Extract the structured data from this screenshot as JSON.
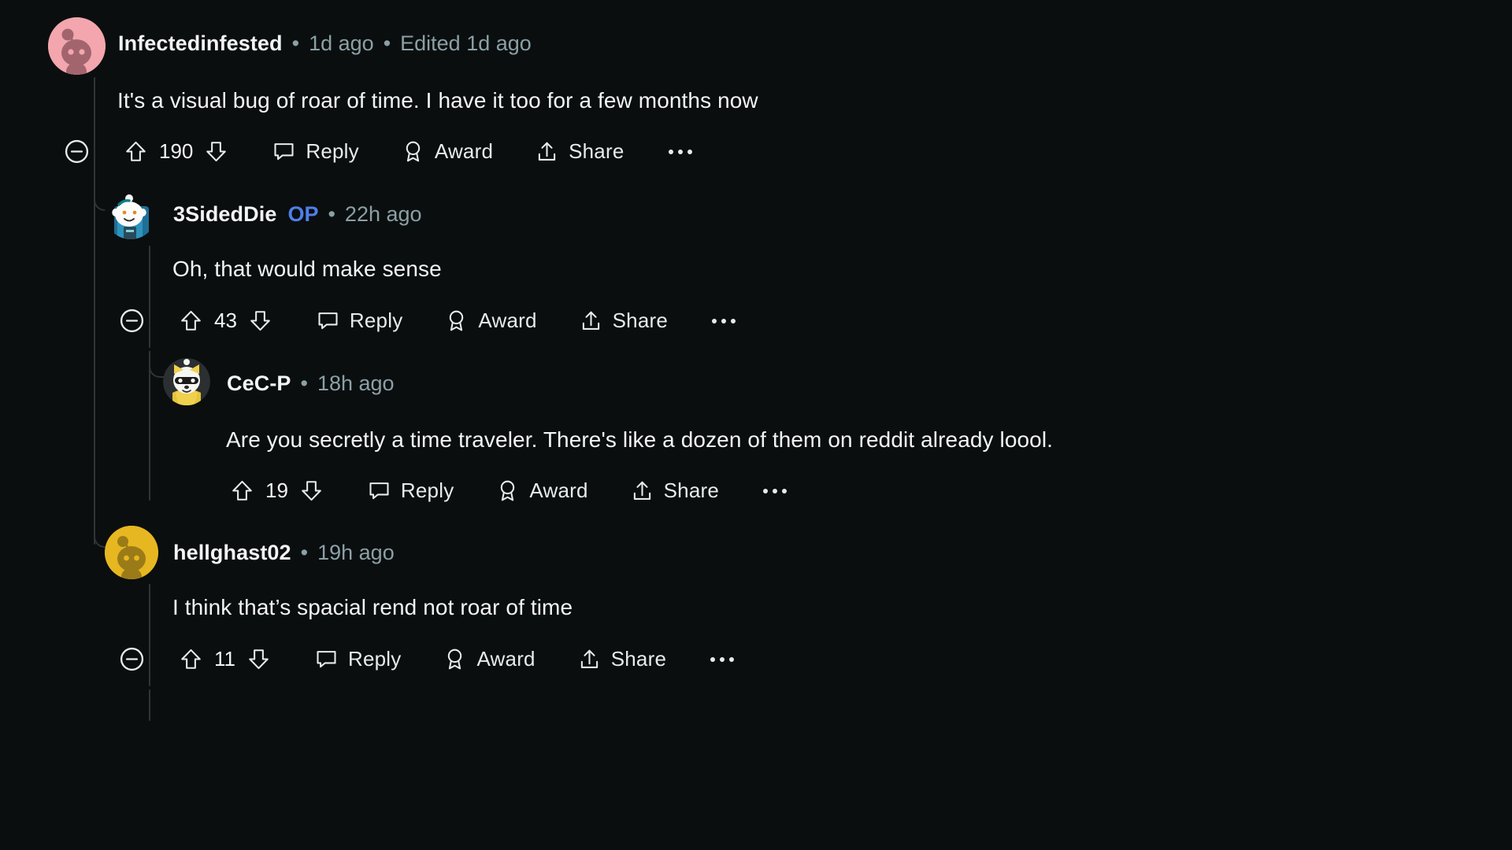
{
  "theme": {
    "background": "#0b0e0f",
    "text_primary": "#f2f4f5",
    "text_meta": "#8ba0a6",
    "op_badge_color": "#4f7fe8",
    "thread_line": "#2e3537"
  },
  "actions": {
    "collapse": "collapse-thread",
    "upvote": "upvote",
    "downvote": "downvote",
    "reply": "Reply",
    "award": "Award",
    "share": "Share",
    "more": "more-options"
  },
  "comments": [
    {
      "id": "c1",
      "depth": 0,
      "username": "Infectedinfested",
      "is_op": false,
      "op_label": "",
      "separator": "•",
      "timestamp": "1d ago",
      "edited": "Edited 1d ago",
      "body": "It's a visual bug of roar of time. I have it too for a few months now",
      "votes": "190",
      "reply_label": "Reply",
      "award_label": "Award",
      "share_label": "Share",
      "has_collapse": true,
      "avatar_style": "pink-snoo"
    },
    {
      "id": "c2",
      "depth": 1,
      "username": "3SidedDie",
      "is_op": true,
      "op_label": "OP",
      "separator": "•",
      "timestamp": "22h ago",
      "edited": "",
      "body": "Oh, that would make sense",
      "votes": "43",
      "reply_label": "Reply",
      "award_label": "Award",
      "share_label": "Share",
      "has_collapse": true,
      "avatar_style": "snoo-avatar"
    },
    {
      "id": "c3",
      "depth": 2,
      "username": "CeC-P",
      "is_op": false,
      "op_label": "",
      "separator": "•",
      "timestamp": "18h ago",
      "edited": "",
      "body": "Are you secretly a time traveler. There's like a dozen of them on reddit already loool.",
      "votes": "19",
      "reply_label": "Reply",
      "award_label": "Award",
      "share_label": "Share",
      "has_collapse": false,
      "avatar_style": "cat-avatar"
    },
    {
      "id": "c4",
      "depth": 1,
      "username": "hellghast02",
      "is_op": false,
      "op_label": "",
      "separator": "•",
      "timestamp": "19h ago",
      "edited": "",
      "body": "I think that’s spacial rend not roar of time",
      "votes": "11",
      "reply_label": "Reply",
      "award_label": "Award",
      "share_label": "Share",
      "has_collapse": true,
      "avatar_style": "yellow-snoo"
    }
  ]
}
